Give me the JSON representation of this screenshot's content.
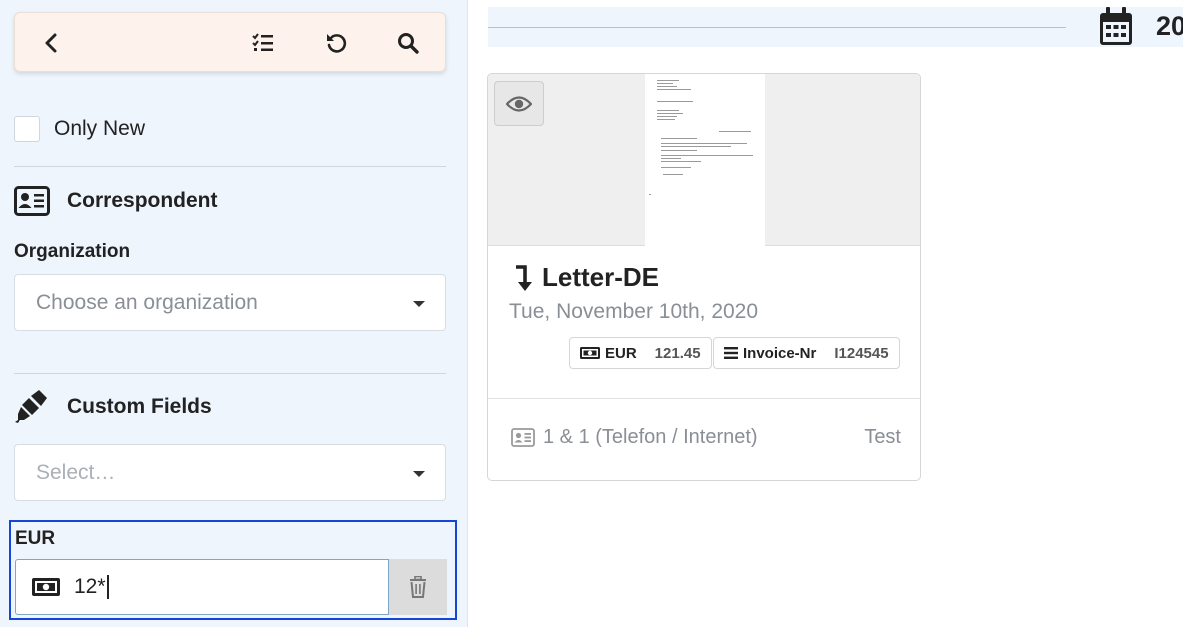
{
  "sidebar": {
    "toolbar": {
      "back_icon": "chevron-left-icon",
      "select_icon": "checklist-icon",
      "reset_icon": "undo-icon",
      "search_icon": "search-icon"
    },
    "only_new_label": "Only New",
    "correspondent": {
      "title": "Correspondent",
      "icon": "id-card-icon",
      "organization_label": "Organization",
      "organization_placeholder": "Choose an organization"
    },
    "custom_fields": {
      "title": "Custom Fields",
      "icon": "highlighter-icon",
      "select_placeholder": "Select…"
    },
    "eur_filter": {
      "label": "EUR",
      "icon": "money-bill-icon",
      "value": "12*"
    }
  },
  "main": {
    "top_year": "20",
    "document": {
      "title": "Letter-DE",
      "date": "Tue, November 10th, 2020",
      "tags": [
        {
          "name": "EUR",
          "value": "121.45",
          "icon": "money-bill-icon"
        },
        {
          "name": "Invoice-Nr",
          "value": "I124545",
          "icon": "bars-icon"
        }
      ],
      "correspondent": "1 & 1 (Telefon / Internet)",
      "document_type": "Test"
    }
  },
  "colors": {
    "sidebar_bg": "#eef5fc",
    "toolbar_bg": "#fdf3ec",
    "focus_border": "#1746d6"
  }
}
